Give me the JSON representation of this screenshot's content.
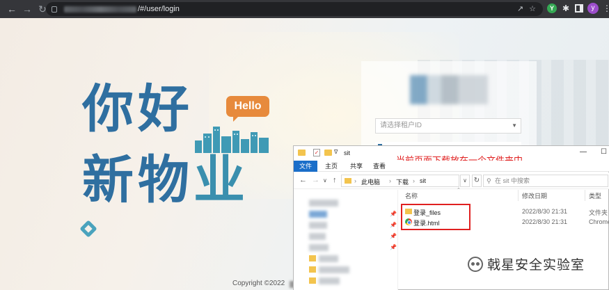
{
  "browser": {
    "url_suffix": "/#/user/login",
    "profile_initial": "y",
    "extension_initial": "Y"
  },
  "hero": {
    "line1": "你好",
    "line2a": "新物",
    "line2b": "业",
    "hello_badge": "Hello"
  },
  "login": {
    "tenant_placeholder": "请选择租户ID"
  },
  "footer": {
    "copyright": "Copyright ©2022"
  },
  "explorer": {
    "title": "sit",
    "annotation": "当前页面下载放在一个文件夹中",
    "ribbon_tabs": [
      "文件",
      "主页",
      "共享",
      "查看"
    ],
    "breadcrumb": [
      "此电脑",
      "下载",
      "sit"
    ],
    "search_placeholder": "在 sit 中搜索",
    "columns": [
      "名称",
      "修改日期",
      "类型"
    ],
    "files": [
      {
        "name": "登录_files",
        "date": "2022/8/30 21:31",
        "type": "文件夹",
        "icon": "folder-icon"
      },
      {
        "name": "登录.html",
        "date": "2022/8/30 21:31",
        "type": "Chrome",
        "icon": "chrome-icon"
      }
    ]
  },
  "watermark": {
    "text": "戟星安全实验室"
  },
  "colors": {
    "hero_blue": "#2f6fa0",
    "hello_orange": "#e78a3c",
    "annotation_red": "#e02020",
    "ribbon_active": "#1a6ec9"
  }
}
